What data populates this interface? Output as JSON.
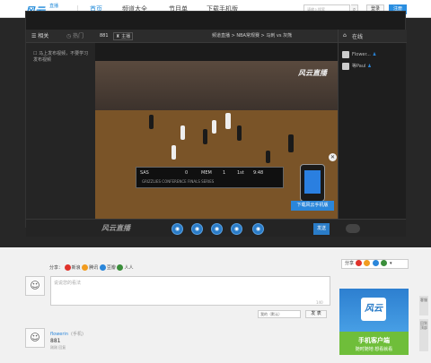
{
  "header": {
    "logo": "风云",
    "logo_sub": "直播",
    "nav": [
      "首页",
      "频道大全",
      "节目单",
      "下载手机版"
    ],
    "search_placeholder": "请输入搜索",
    "login": "登录",
    "register": "注册"
  },
  "player": {
    "tabs": [
      "相关",
      "热门"
    ],
    "source_label": "881",
    "source_pill": "主播",
    "breadcrumb": "频道直播 > NBA常规赛 > 马刺 vs 灰熊",
    "video_list_item": "马上发布视频，不要学习发布视频",
    "watermark": "风云直播",
    "scoreboard": {
      "team1": "SAS",
      "score1": "0",
      "team2": "MEM",
      "score2": "1",
      "quarter": "1st",
      "clock": "9:48",
      "caption": "GRIZZLIES CONFERENCE FINALS SERIES"
    },
    "download_banner": "下载风云手机版",
    "control_logo": "风云直播",
    "control_icons": [
      "◉",
      "◉",
      "◉",
      "◉",
      "◉"
    ],
    "send_button": "发送"
  },
  "chat": {
    "title": "在线",
    "users": [
      "Flower...",
      "等Paul"
    ]
  },
  "comments": {
    "share_label": "分享：",
    "share_targets": [
      "新浪",
      "腾讯",
      "豆瓣",
      "人人"
    ],
    "share_colors": [
      "#e0322b",
      "#f29c1f",
      "#2a86da",
      "#3a8e3a"
    ],
    "right_share_label": "分享",
    "placeholder": "说说您的看法",
    "counter": "140",
    "select_value": "我的（默认）",
    "submit": "发 表",
    "entry": {
      "user": "flowerin",
      "from": "(手机)",
      "text": "881",
      "time": "刚刚 回复",
      "avatar": "☺"
    }
  },
  "ad": {
    "logo": "风云",
    "line1": "手机客户端",
    "line2": "随时随地 想看就看"
  },
  "side_buttons": [
    "客服",
    "回到顶部"
  ]
}
